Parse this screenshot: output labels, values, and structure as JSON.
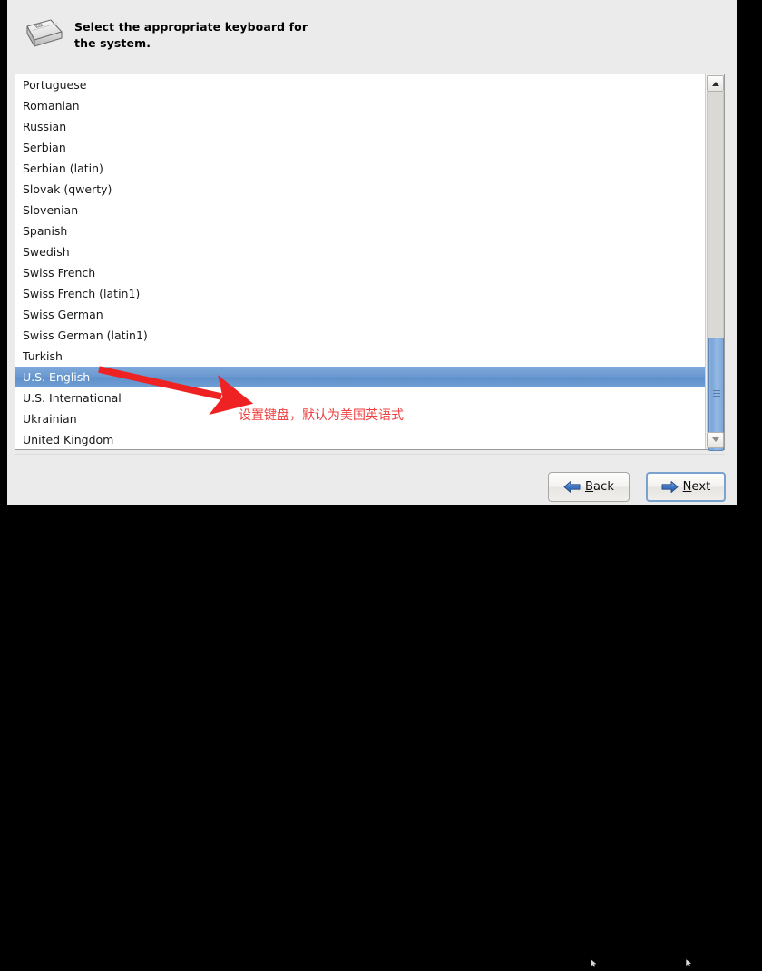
{
  "header": {
    "icon": "keyboard-icon",
    "instruction_line1": "Select the appropriate keyboard for",
    "instruction_line2": "the system.",
    "instruction_full": "Select the appropriate keyboard for the system."
  },
  "keyboard_list": {
    "name": "keyboard-layout-list",
    "selected_value": "U.S. English",
    "visible_items": [
      "Portuguese",
      "Romanian",
      "Russian",
      "Serbian",
      "Serbian (latin)",
      "Slovak (qwerty)",
      "Slovenian",
      "Spanish",
      "Swedish",
      "Swiss French",
      "Swiss French (latin1)",
      "Swiss German",
      "Swiss German (latin1)",
      "Turkish",
      "U.S. English",
      "U.S. International",
      "Ukrainian",
      "United Kingdom"
    ],
    "selection_color": "#6a99d0",
    "selection_text_color": "#ffffff"
  },
  "scrollbar": {
    "up_arrow": "chevron-up-icon",
    "down_arrow": "chevron-down-icon",
    "thumb_color": "#7ba5d8",
    "track_color": "#dbd9d5"
  },
  "annotation": {
    "text": "设置键盘，默认为美国英语式",
    "color": "#f04040",
    "arrow": "red-arrow-pointer"
  },
  "footer": {
    "back_button": {
      "label_prefix": "",
      "mnemonic": "B",
      "label_suffix": "ack",
      "icon": "arrow-left-icon"
    },
    "next_button": {
      "label_prefix": "",
      "mnemonic": "N",
      "label_suffix": "ext",
      "icon": "arrow-right-icon",
      "focused": true
    }
  },
  "colors": {
    "window_background": "#ebebeb",
    "list_background": "#ffffff",
    "accent_blue": "#6a99d0",
    "annotation_red": "#f04040"
  }
}
